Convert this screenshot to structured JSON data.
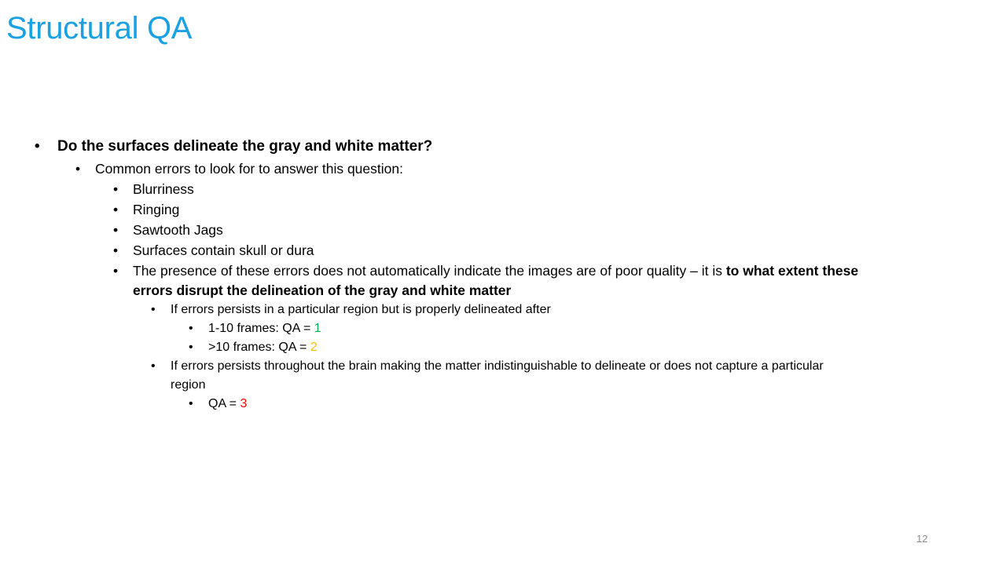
{
  "slide": {
    "title": "Structural QA",
    "page_number": "12"
  },
  "bullets": {
    "q": "Do the surfaces delineate the gray and white matter?",
    "common": "Common errors to look for to answer this question:",
    "e1": "Blurriness",
    "e2": "Ringing",
    "e3": "Sawtooth Jags",
    "e4": "Surfaces contain skull or dura",
    "presence_a": "The presence of these errors does not automatically indicate the images are of poor quality – it is ",
    "presence_b": "to what extent these",
    "presence_c": "errors disrupt the delineation of the gray and white matter",
    "region": "If errors persists in a particular region but is properly delineated after",
    "f1_label": "1-10 frames: QA = ",
    "f1_value": "1",
    "f2_label": ">10 frames: QA = ",
    "f2_value": "2",
    "brain_a": "If errors persists throughout the brain making the matter indistinguishable to delineate or does not capture a particular",
    "brain_b": "region",
    "qa3_label": "QA = ",
    "qa3_value": "3",
    "bullet_char": "•"
  },
  "colors": {
    "title": "#1ba1e2",
    "qa1": "#00b050",
    "qa2": "#ffc000",
    "qa3": "#ff0000"
  }
}
